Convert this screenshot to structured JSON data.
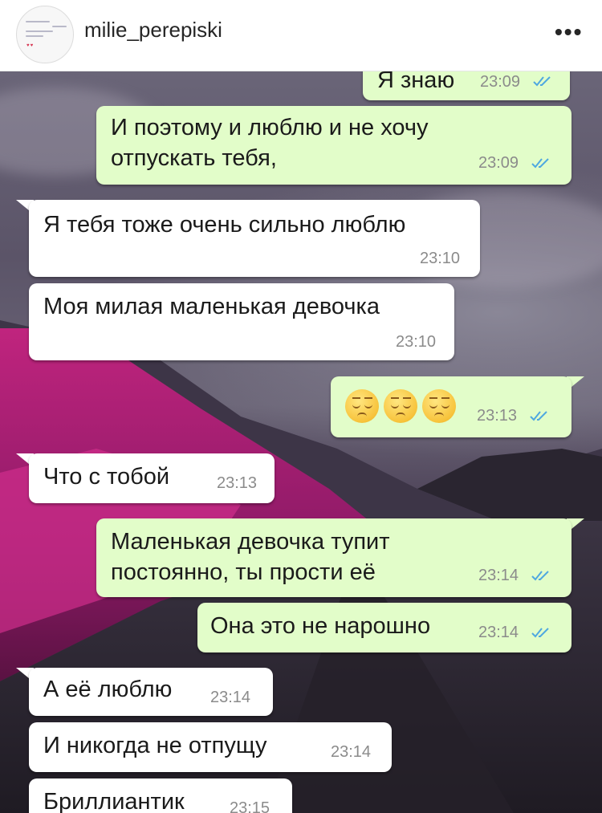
{
  "header": {
    "username": "milie_perepiski",
    "more_icon": "ellipsis-icon"
  },
  "messages": [
    {
      "dir": "out",
      "text": "Я знаю",
      "time": "23:09",
      "status": "read"
    },
    {
      "dir": "out",
      "line1": "И поэтому и люблю и не хочу",
      "line2": "отпускать тебя,",
      "time": "23:09",
      "status": "read"
    },
    {
      "dir": "in",
      "text": "Я тебя тоже очень сильно люблю",
      "time": "23:10"
    },
    {
      "dir": "in",
      "text": "Моя милая маленькая девочка",
      "time": "23:10"
    },
    {
      "dir": "out",
      "emoji": "😔😔😔",
      "emoji_name": "pensive-face",
      "time": "23:13",
      "status": "read"
    },
    {
      "dir": "in",
      "text": "Что с тобой",
      "time": "23:13"
    },
    {
      "dir": "out",
      "line1": "Маленькая девочка тупит",
      "line2": "постоянно, ты прости её",
      "time": "23:14",
      "status": "read"
    },
    {
      "dir": "out",
      "text": "Она это не нарошно",
      "time": "23:14",
      "status": "read"
    },
    {
      "dir": "in",
      "text": "А её люблю",
      "time": "23:14"
    },
    {
      "dir": "in",
      "text": "И никогда не отпущу",
      "time": "23:14"
    },
    {
      "dir": "in",
      "text": "Бриллиантик",
      "time": "23:15"
    }
  ],
  "colors": {
    "outgoing_bubble": "#e2fdc9",
    "incoming_bubble": "#ffffff",
    "read_ticks": "#4fa8e0"
  }
}
